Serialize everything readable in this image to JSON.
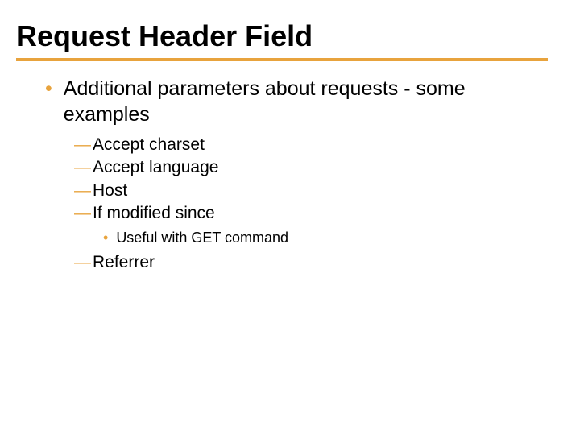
{
  "title": "Request Header Field",
  "level1": {
    "bullet": "•",
    "text": "Additional parameters about requests - some examples"
  },
  "dash": "—",
  "sub_bullet": "•",
  "items": {
    "a": "Accept charset",
    "b": "Accept language",
    "c": "Host",
    "d": "If modified since",
    "d_sub": "Useful with GET command",
    "e": "Referrer"
  }
}
